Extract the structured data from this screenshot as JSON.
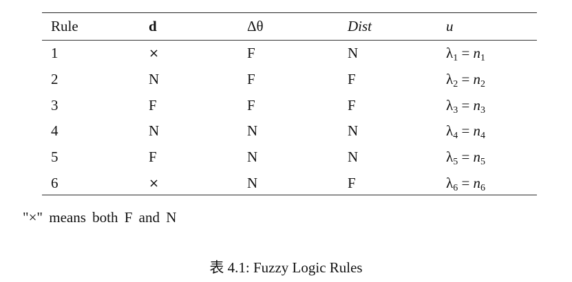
{
  "table": {
    "headers": [
      "Rule",
      "d",
      "Δθ",
      "Dist",
      "u"
    ],
    "rows": [
      {
        "rule": "1",
        "d": "×",
        "dtheta": "F",
        "dist": "N",
        "u_lambda": "λ",
        "u_sub": "1",
        "u_eq": " = ",
        "u_n": "n",
        "u_nsub": "1"
      },
      {
        "rule": "2",
        "d": "N",
        "dtheta": "F",
        "dist": "F",
        "u_lambda": "λ",
        "u_sub": "2",
        "u_eq": " = ",
        "u_n": "n",
        "u_nsub": "2"
      },
      {
        "rule": "3",
        "d": "F",
        "dtheta": "F",
        "dist": "F",
        "u_lambda": "λ",
        "u_sub": "3",
        "u_eq": " = ",
        "u_n": "n",
        "u_nsub": "3"
      },
      {
        "rule": "4",
        "d": "N",
        "dtheta": "N",
        "dist": "N",
        "u_lambda": "λ",
        "u_sub": "4",
        "u_eq": " = ",
        "u_n": "n",
        "u_nsub": "4"
      },
      {
        "rule": "5",
        "d": "F",
        "dtheta": "N",
        "dist": "N",
        "u_lambda": "λ",
        "u_sub": "5",
        "u_eq": " = ",
        "u_n": "n",
        "u_nsub": "5"
      },
      {
        "rule": "6",
        "d": "×",
        "dtheta": "N",
        "dist": "F",
        "u_lambda": "λ",
        "u_sub": "6",
        "u_eq": " = ",
        "u_n": "n",
        "u_nsub": "6"
      }
    ]
  },
  "note": "\"×\" means both F and N",
  "caption": "表 4.1: Fuzzy Logic Rules"
}
